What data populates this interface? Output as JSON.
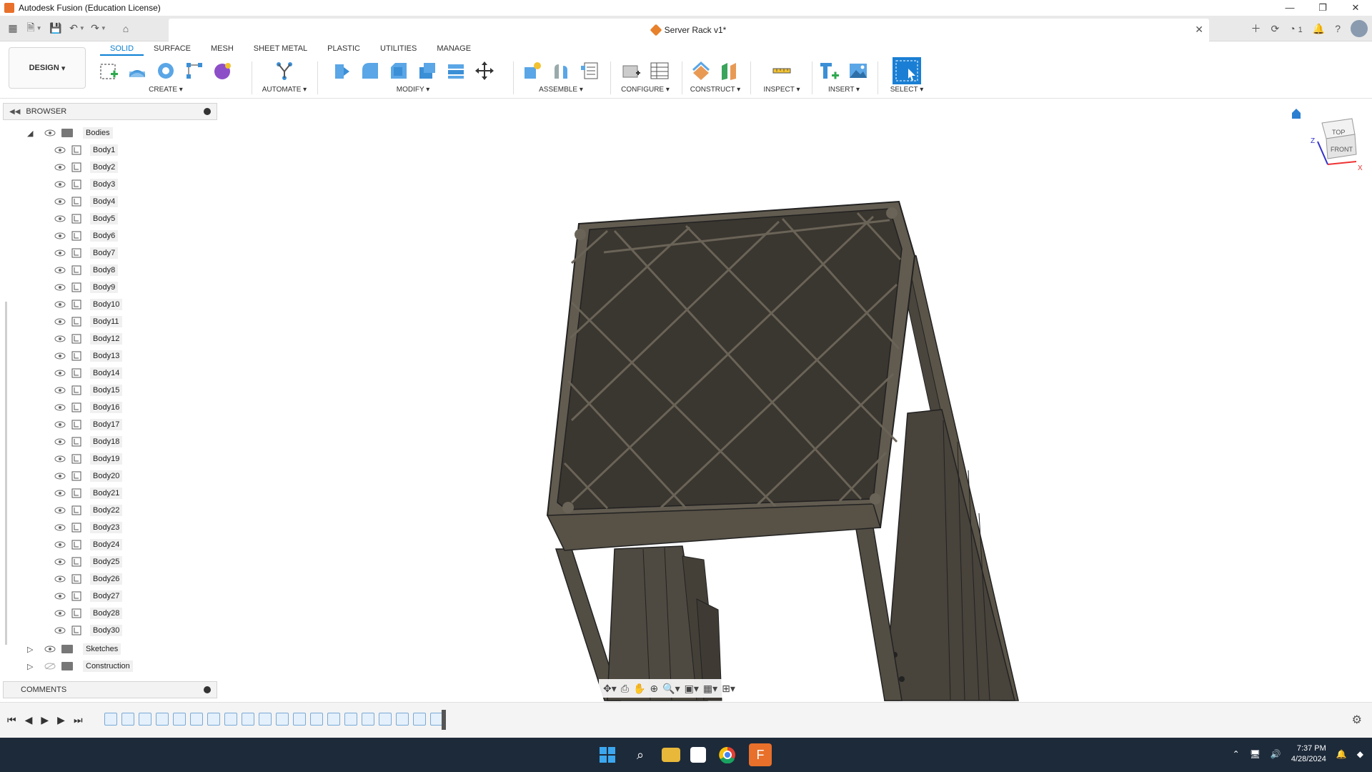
{
  "window": {
    "title": "Autodesk Fusion (Education License)",
    "controls": [
      "—",
      "❐",
      "✕"
    ]
  },
  "document": {
    "title": "Server Rack v1*",
    "jobs_count": "1"
  },
  "workspace": {
    "label": "DESIGN"
  },
  "tabs": [
    "SOLID",
    "SURFACE",
    "MESH",
    "SHEET METAL",
    "PLASTIC",
    "UTILITIES",
    "MANAGE"
  ],
  "groups": {
    "create": "CREATE",
    "automate": "AUTOMATE",
    "modify": "MODIFY",
    "assemble": "ASSEMBLE",
    "configure": "CONFIGURE",
    "construct": "CONSTRUCT",
    "inspect": "INSPECT",
    "insert": "INSERT",
    "select": "SELECT"
  },
  "browser": {
    "title": "BROWSER",
    "bodies_folder": "Bodies",
    "bodies": [
      "Body1",
      "Body2",
      "Body3",
      "Body4",
      "Body5",
      "Body6",
      "Body7",
      "Body8",
      "Body9",
      "Body10",
      "Body11",
      "Body12",
      "Body13",
      "Body14",
      "Body15",
      "Body16",
      "Body17",
      "Body18",
      "Body19",
      "Body20",
      "Body21",
      "Body22",
      "Body23",
      "Body24",
      "Body25",
      "Body26",
      "Body27",
      "Body28",
      "Body30"
    ],
    "sketches_folder": "Sketches",
    "construction_folder": "Construction"
  },
  "comments": {
    "title": "COMMENTS"
  },
  "viewcube": {
    "top": "TOP",
    "front": "FRONT",
    "axis_x": "X",
    "axis_z": "Z"
  },
  "taskbar": {
    "time": "7:37 PM",
    "date": "4/28/2024"
  },
  "colors": {
    "accent": "#0a7fd3",
    "model": "#4a453d",
    "taskbar": "#1d2a3a"
  }
}
